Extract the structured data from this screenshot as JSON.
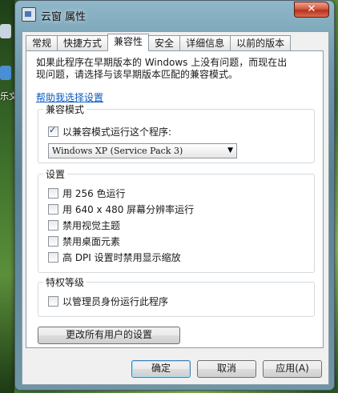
{
  "desktop": {
    "left_label": "乐文"
  },
  "window": {
    "title": "云窗 属性",
    "close_label": "✕"
  },
  "tabs": [
    {
      "label": "常规",
      "active": false
    },
    {
      "label": "快捷方式",
      "active": false
    },
    {
      "label": "兼容性",
      "active": true
    },
    {
      "label": "安全",
      "active": false
    },
    {
      "label": "详细信息",
      "active": false
    },
    {
      "label": "以前的版本",
      "active": false
    }
  ],
  "compat": {
    "intro_line1": "如果此程序在早期版本的 Windows 上没有问题，而现在出",
    "intro_line2": "现问题，请选择与该早期版本匹配的兼容模式。",
    "help_link": "帮助我选择设置",
    "mode_group": {
      "label": "兼容模式",
      "checkbox_label": "以兼容模式运行这个程序:",
      "checked": true,
      "selected_os": "Windows XP (Service Pack 3)"
    },
    "settings_group": {
      "label": "设置",
      "options": [
        {
          "label": "用 256 色运行",
          "checked": false
        },
        {
          "label": "用 640 x 480 屏幕分辨率运行",
          "checked": false
        },
        {
          "label": "禁用视觉主题",
          "checked": false
        },
        {
          "label": "禁用桌面元素",
          "checked": false
        },
        {
          "label": "高 DPI 设置时禁用显示缩放",
          "checked": false
        }
      ]
    },
    "privilege_group": {
      "label": "特权等级",
      "checkbox_label": "以管理员身份运行此程序",
      "checked": false
    },
    "all_users_button": "更改所有用户的设置"
  },
  "buttons": {
    "ok": "确定",
    "cancel": "取消",
    "apply": "应用(A)"
  }
}
